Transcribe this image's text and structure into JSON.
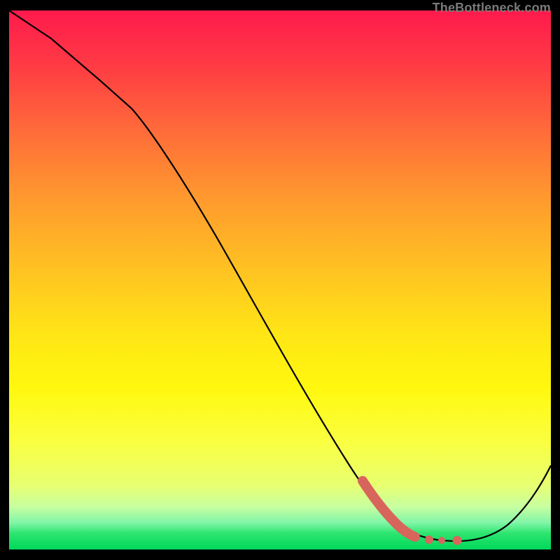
{
  "watermark": "TheBottleneck.com",
  "chart_data": {
    "type": "line",
    "title": "",
    "xlabel": "",
    "ylabel": "",
    "xlim": [
      0,
      100
    ],
    "ylim": [
      0,
      100
    ],
    "series": [
      {
        "name": "main-curve",
        "x": [
          0,
          5,
          12,
          20,
          28,
          35,
          42,
          50,
          57,
          63,
          69,
          74,
          78,
          82,
          86,
          90,
          94,
          100
        ],
        "y": [
          100,
          94,
          85,
          75,
          62,
          50,
          38,
          27,
          17,
          10,
          5,
          2,
          1,
          1,
          1,
          2,
          5,
          16
        ]
      },
      {
        "name": "highlight-segment",
        "x": [
          65,
          67,
          69,
          71,
          73,
          74.5,
          76,
          78,
          80,
          82
        ],
        "y": [
          12,
          10,
          8,
          6,
          4,
          3,
          2,
          1.5,
          1.5,
          1.5
        ]
      }
    ],
    "colors": {
      "main_curve": "#000000",
      "highlight": "#d8655c"
    },
    "grid": false,
    "legend": false
  }
}
